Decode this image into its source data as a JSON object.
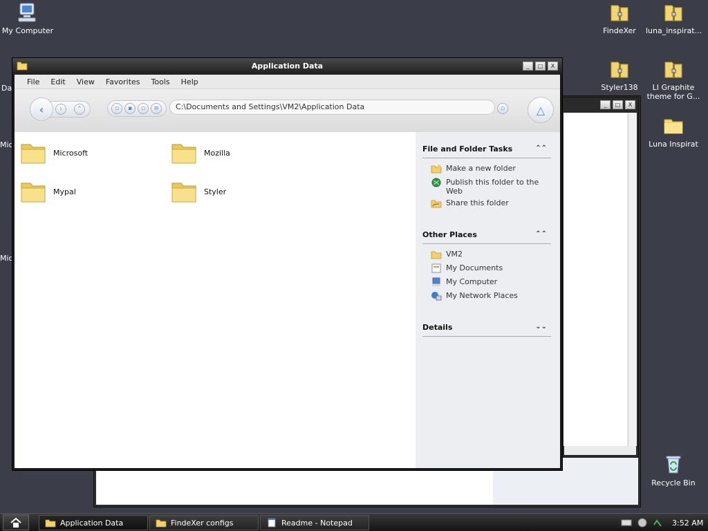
{
  "desktop": {
    "icons_left": [
      {
        "label": "My Computer"
      }
    ],
    "clipped_labels": [
      "Da",
      "Mic",
      "Mic"
    ],
    "icons_right": [
      {
        "label": "FindeXer"
      },
      {
        "label": "luna_inspirat..."
      },
      {
        "label": "Styler138"
      },
      {
        "label": "LI Graphite theme for G..."
      },
      {
        "label": "Luna Inspirat"
      },
      {
        "label": "Recycle Bin"
      }
    ]
  },
  "window": {
    "title": "Application Data",
    "controls": {
      "minimize": "_",
      "maximize": "□",
      "close": "X"
    }
  },
  "menu": [
    "File",
    "Edit",
    "View",
    "Favorites",
    "Tools",
    "Help"
  ],
  "address": {
    "value": "C:\\Documents and Settings\\VM2\\Application Data"
  },
  "folders": [
    "Microsoft",
    "Mozilla",
    "Mypal",
    "Styler"
  ],
  "panels": {
    "file_tasks": {
      "title": "File and Folder Tasks",
      "items": [
        "Make a new folder",
        "Publish this folder to the Web",
        "Share this folder"
      ]
    },
    "other_places": {
      "title": "Other Places",
      "items": [
        "VM2",
        "My Documents",
        "My Computer",
        "My Network Places"
      ]
    },
    "details": {
      "title": "Details"
    }
  },
  "taskbar": {
    "buttons": [
      "Application Data",
      "FindeXer configs",
      "Readme - Notepad"
    ],
    "clock": "3:52 AM"
  }
}
